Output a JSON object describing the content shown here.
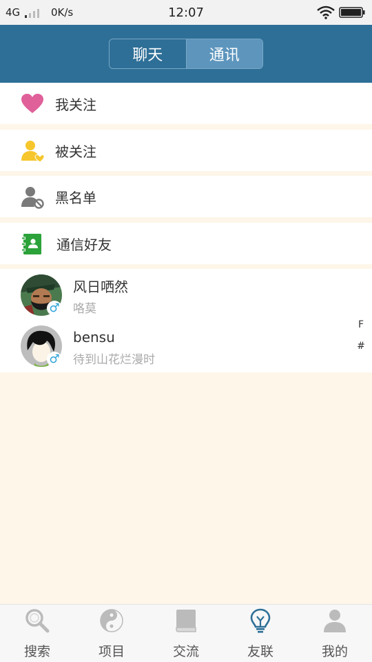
{
  "status_bar": {
    "network": "4G",
    "speed": "0K/s",
    "time": "12:07"
  },
  "header": {
    "tabs": [
      {
        "label": "聊天",
        "selected": false
      },
      {
        "label": "通讯",
        "selected": true
      }
    ]
  },
  "menu": [
    {
      "label": "我关注",
      "icon": "heart-icon"
    },
    {
      "label": "被关注",
      "icon": "user-heart-icon"
    },
    {
      "label": "黑名单",
      "icon": "user-blocked-icon"
    },
    {
      "label": "通信好友",
      "icon": "contact-book-icon"
    }
  ],
  "contacts": [
    {
      "name": "风日哂然",
      "subtitle": "咯莫",
      "gender": "♂"
    },
    {
      "name": "bensu",
      "subtitle": "待到山花烂漫时",
      "gender": "♂"
    }
  ],
  "index_bar": [
    "F",
    "#"
  ],
  "tab_bar": [
    {
      "label": "搜索",
      "icon": "search-icon",
      "active": false
    },
    {
      "label": "项目",
      "icon": "yin-yang-icon",
      "active": false
    },
    {
      "label": "交流",
      "icon": "book-icon",
      "active": false
    },
    {
      "label": "友联",
      "icon": "lightbulb-icon",
      "active": true
    },
    {
      "label": "我的",
      "icon": "profile-icon",
      "active": false
    }
  ],
  "colors": {
    "header": "#2e6f97",
    "segment_selected": "#5d95bd",
    "background": "#fdf6e9",
    "heart": "#e0609a",
    "user_yellow": "#f6c62c",
    "contact_green": "#2ca23a",
    "gender_blue": "#2aa1d8",
    "tab_active": "#2e6f97",
    "tab_inactive": "#bbbbbb"
  }
}
